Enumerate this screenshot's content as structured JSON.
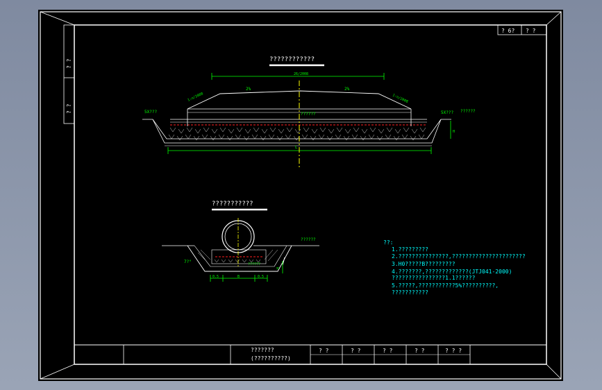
{
  "title_block_corner": {
    "left": "? 6?",
    "right": "? ?"
  },
  "left_margin_marks": [
    "? ?",
    "? ?"
  ],
  "section1": {
    "title": "????????????",
    "dim_top": "26/2008",
    "slope_left": "2%",
    "slope_right": "2%",
    "side_slope_left": "1:n/2008",
    "side_slope_right": "1:n/2008",
    "label_left": "5X???",
    "label_right": "5X???",
    "label_right_extra": "??????",
    "label_center": "??????",
    "label_height": "H",
    "dim_bottom": "L"
  },
  "section2": {
    "title": "???????????",
    "label_right": "??????",
    "label_left": "7?°",
    "label_inner": "??????",
    "dim_left": "0.5",
    "dim_mid": "B",
    "dim_right": "0.5",
    "dim_height": "H"
  },
  "notes": {
    "heading": "??:",
    "lines": [
      "1.?????????",
      "2.???????????????,??????????????????????",
      "3.H0?????B?????????",
      "4.???????,?????????????(JTJ041-2000)",
      "  ????????????????1.1??????",
      "5.?????,???????????5%??????????,",
      "  ???????????"
    ]
  },
  "title_block": {
    "name_line1": "???????",
    "name_line2": "(??????????)",
    "cells": [
      "? ?",
      "? ?",
      "? ?",
      "? ?",
      "? ? ?"
    ]
  },
  "colors": {
    "background": "#000000",
    "lines": "#ffffff",
    "dims": "#00ff00",
    "centerline": "#ffff00",
    "accent_red": "#ff2020",
    "text_cyan": "#00ffff"
  }
}
